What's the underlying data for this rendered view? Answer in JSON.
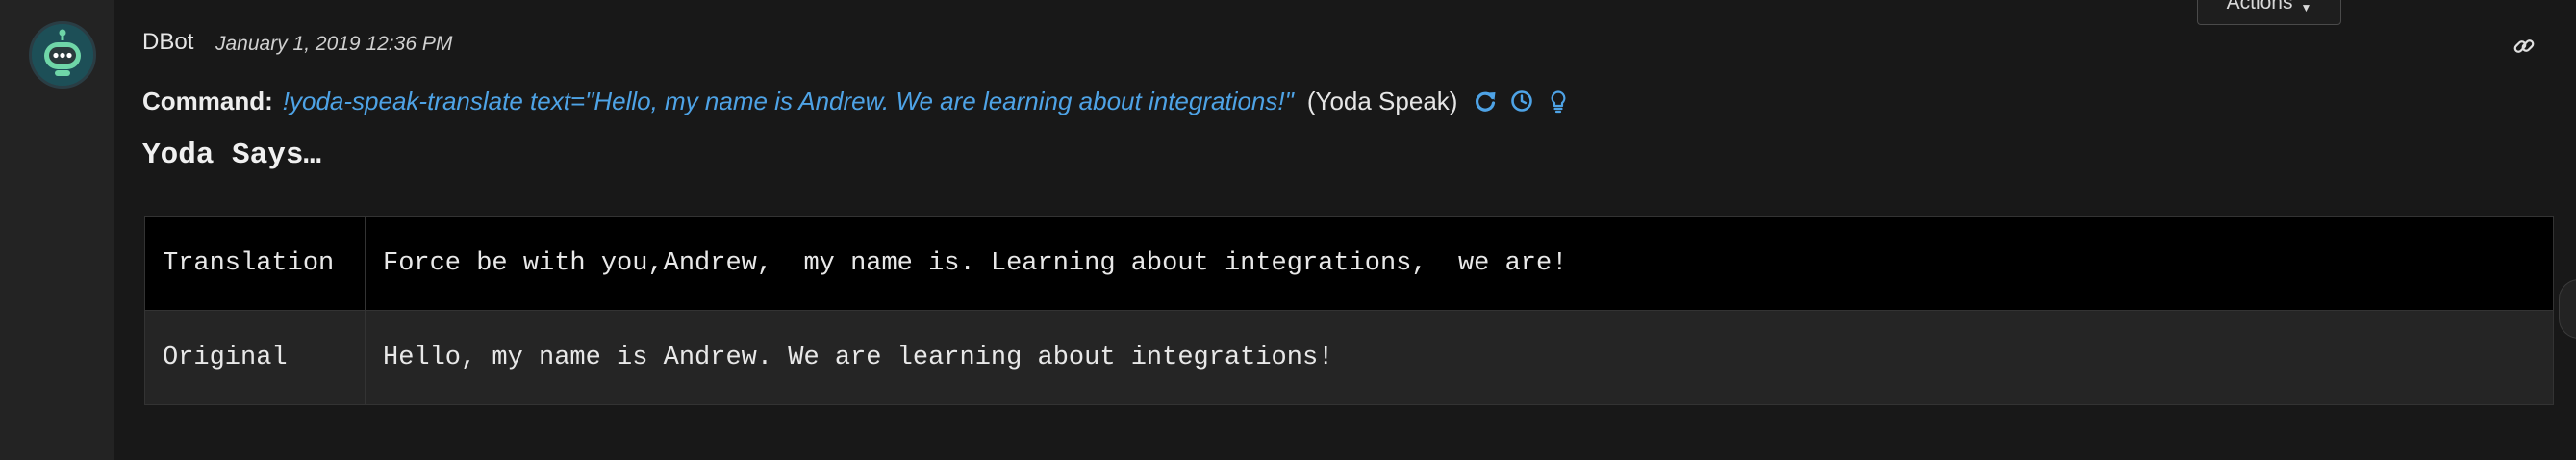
{
  "message": {
    "author": "DBot",
    "timestamp": "January 1, 2019 12:36 PM",
    "actions_label": "Actions",
    "command_label": "Command:",
    "command_text": "!yoda-speak-translate text=\"Hello, my name is Andrew. We are learning about integrations!\"",
    "integration": "(Yoda Speak)",
    "result_heading": "Yoda Says…",
    "result_table": {
      "rows": [
        {
          "key": "Translation",
          "value": "Force be with you,Andrew,  my name is. Learning about integrations,  we are!"
        },
        {
          "key": "Original",
          "value": "Hello, my name is Andrew. We are learning about integrations!"
        }
      ]
    }
  },
  "icons": {
    "avatar": "dbot-robot-icon",
    "link": "link-icon",
    "rerun": "rerun-icon",
    "history": "history-icon",
    "hint": "lightbulb-icon",
    "actions_caret": "chevron-down-icon"
  },
  "colors": {
    "background": "#181818",
    "gutter": "#232323",
    "accent": "#4ea3e6",
    "avatar_bg": "#1d4f57",
    "robot_green": "#6fd6a8"
  }
}
